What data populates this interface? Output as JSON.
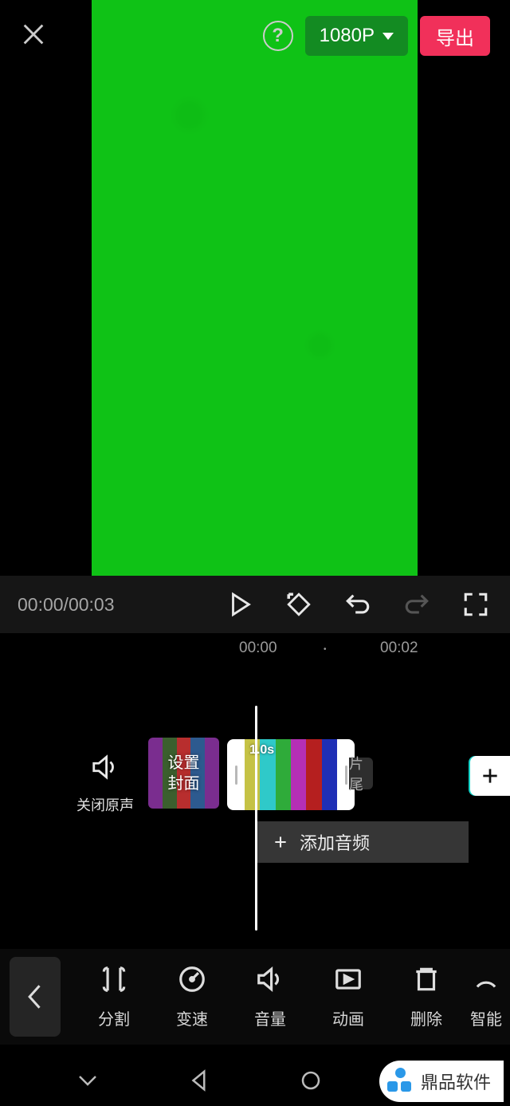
{
  "header": {
    "resolution": "1080P",
    "help": "?",
    "export": "导出"
  },
  "player": {
    "time": "00:00/00:03"
  },
  "ruler": {
    "t0": "00:00",
    "t2": "00:02"
  },
  "timeline": {
    "mute_label": "关闭原声",
    "cover_label": "设置\n封面",
    "clip_duration": "1.0s",
    "end_label": "片尾",
    "add_audio": "添加音频"
  },
  "tools": {
    "split": "分割",
    "speed": "变速",
    "volume": "音量",
    "anim": "动画",
    "delete": "删除",
    "smart": "智能"
  },
  "watermark": {
    "text": "鼎品软件"
  }
}
